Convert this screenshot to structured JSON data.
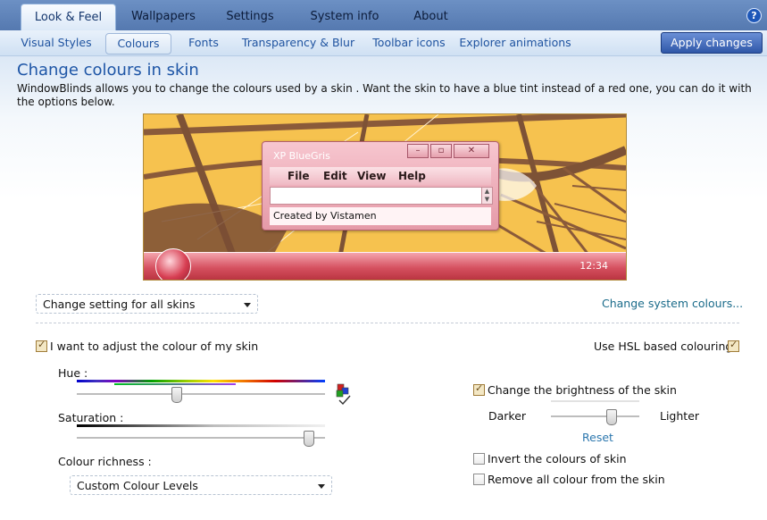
{
  "main_tabs": [
    {
      "label": "Look & Feel",
      "active": true
    },
    {
      "label": "Wallpapers",
      "active": false
    },
    {
      "label": "Settings",
      "active": false
    },
    {
      "label": "System info",
      "active": false
    },
    {
      "label": "About",
      "active": false
    }
  ],
  "help": {
    "label": "?"
  },
  "sub_tabs": [
    {
      "label": "Visual Styles",
      "active": false
    },
    {
      "label": "Colours",
      "active": true
    },
    {
      "label": "Fonts",
      "active": false
    },
    {
      "label": "Transparency & Blur",
      "active": false
    },
    {
      "label": "Toolbar icons",
      "active": false
    },
    {
      "label": "Explorer animations",
      "active": false
    }
  ],
  "apply_label": "Apply changes",
  "page": {
    "title": "Change colours in skin",
    "description": "WindowBlinds allows you to change the colours used by a skin .  Want the skin to have a blue tint instead of a red one, you can do it with the options below."
  },
  "preview": {
    "window_title": "XP BlueGris",
    "min_label": "–",
    "max_label": "▫",
    "close_label": "✕",
    "menu": [
      "File",
      "Edit",
      "View",
      "Help"
    ],
    "spin_up": "▲",
    "spin_down": "▼",
    "status": "Created by Vistamen",
    "clock": "12:34"
  },
  "scope_dropdown": {
    "value": "Change setting for all skins"
  },
  "system_colours_link": "Change system colours...",
  "adjust": {
    "label": "I want to adjust the colour of my skin",
    "checked": true
  },
  "hsl": {
    "label": "Use HSL based colouring",
    "checked": true
  },
  "hue": {
    "label": "Hue :",
    "level_percent": 40
  },
  "saturation": {
    "label": "Saturation :",
    "level_percent": 93
  },
  "richness": {
    "label": "Colour richness :",
    "value": "Custom Colour Levels"
  },
  "brightness": {
    "label": "Change the brightness of the skin",
    "checked": true,
    "darker": "Darker",
    "lighter": "Lighter",
    "level_percent": 68,
    "reset": "Reset"
  },
  "invert": {
    "label": "Invert the colours of skin",
    "checked": false
  },
  "remove": {
    "label": "Remove all colour from the skin",
    "checked": false
  },
  "colors": {
    "accent": "#1d55a6",
    "apply": "#2f57a8",
    "link": "#1a6b8a"
  }
}
